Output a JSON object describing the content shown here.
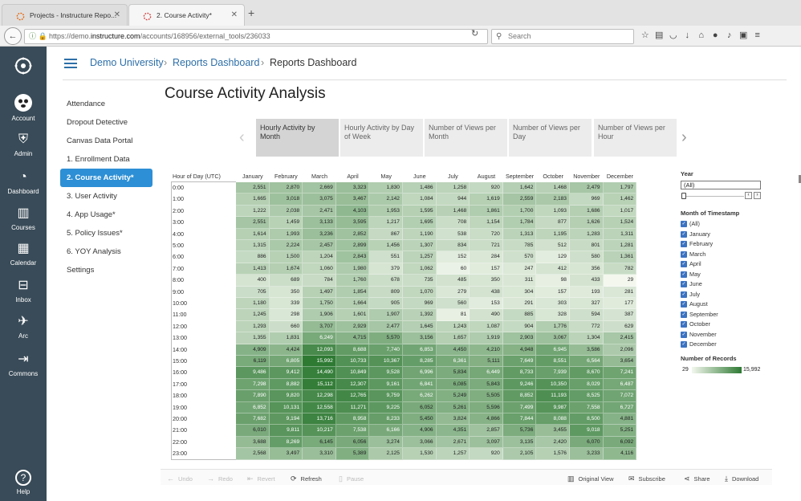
{
  "browser": {
    "tabs": [
      {
        "title": "Projects - Instructure Repo..."
      },
      {
        "title": "2. Course Activity*"
      }
    ],
    "url": {
      "prefix": "https://demo.",
      "domain": "instructure.com",
      "path": "/accounts/168956/external_tools/236033"
    },
    "search_placeholder": "Search"
  },
  "global_nav": {
    "items": [
      {
        "label": "Account",
        "icon": "account-avatar-icon"
      },
      {
        "label": "Admin",
        "icon": "admin-shield-icon"
      },
      {
        "label": "Dashboard",
        "icon": "dashboard-gauge-icon"
      },
      {
        "label": "Courses",
        "icon": "courses-book-icon"
      },
      {
        "label": "Calendar",
        "icon": "calendar-icon"
      },
      {
        "label": "Inbox",
        "icon": "inbox-tray-icon"
      },
      {
        "label": "Arc",
        "icon": "arc-icon"
      },
      {
        "label": "Commons",
        "icon": "commons-icon"
      },
      {
        "label": "Help",
        "icon": "help-circle-icon"
      }
    ]
  },
  "breadcrumb": [
    "Demo University",
    "Reports Dashboard",
    "Reports Dashboard"
  ],
  "sub_nav": [
    {
      "label": "Attendance",
      "active": false
    },
    {
      "label": "Dropout Detective",
      "active": false
    },
    {
      "label": "Canvas Data Portal",
      "active": false
    },
    {
      "label": "1. Enrollment Data",
      "active": false
    },
    {
      "label": "2. Course Activity*",
      "active": true
    },
    {
      "label": "3. User Activity",
      "active": false
    },
    {
      "label": "4. App Usage*",
      "active": false
    },
    {
      "label": "5. Policy Issues*",
      "active": false
    },
    {
      "label": "6. YOY Analysis",
      "active": false
    },
    {
      "label": "Settings",
      "active": false
    }
  ],
  "page_title": "Course Activity Analysis",
  "view_tabs": [
    {
      "label": "Hourly Activity by Month",
      "active": true
    },
    {
      "label": "Hourly Activity by Day of Week",
      "active": false
    },
    {
      "label": "Number of Views per Month",
      "active": false
    },
    {
      "label": "Number of Views per Day",
      "active": false
    },
    {
      "label": "Number of Views per Hour",
      "active": false
    }
  ],
  "chart_data": {
    "type": "heatmap",
    "row_header": "Hour of Day (UTC)",
    "columns": [
      "January",
      "February",
      "March",
      "April",
      "May",
      "June",
      "July",
      "August",
      "September",
      "October",
      "November",
      "December"
    ],
    "rows": [
      "0:00",
      "1:00",
      "2:00",
      "3:00",
      "4:00",
      "5:00",
      "6:00",
      "7:00",
      "8:00",
      "9:00",
      "10:00",
      "11:00",
      "12:00",
      "13:00",
      "14:00",
      "15:00",
      "16:00",
      "17:00",
      "18:00",
      "19:00",
      "20:00",
      "21:00",
      "22:00",
      "23:00"
    ],
    "values": [
      [
        2551,
        2870,
        2669,
        3323,
        1830,
        1486,
        1258,
        920,
        1642,
        1468,
        2479,
        1797
      ],
      [
        1665,
        3018,
        3075,
        3467,
        2142,
        1084,
        944,
        1619,
        2559,
        2183,
        969,
        1462
      ],
      [
        1222,
        2038,
        2471,
        4103,
        1953,
        1595,
        1468,
        1861,
        1700,
        1093,
        1686,
        1017
      ],
      [
        2551,
        1459,
        3133,
        3595,
        1217,
        1695,
        708,
        1154,
        1784,
        877,
        1626,
        1524
      ],
      [
        1614,
        1993,
        3236,
        2852,
        867,
        1190,
        538,
        720,
        1313,
        1195,
        1283,
        1311
      ],
      [
        1315,
        2224,
        2457,
        2899,
        1456,
        1307,
        834,
        721,
        785,
        512,
        801,
        1281
      ],
      [
        886,
        1500,
        1204,
        2843,
        551,
        1257,
        152,
        284,
        570,
        129,
        580,
        1361
      ],
      [
        1413,
        1674,
        1060,
        1980,
        379,
        1062,
        60,
        157,
        247,
        412,
        356,
        782
      ],
      [
        400,
        689,
        784,
        1760,
        678,
        735,
        485,
        350,
        311,
        98,
        433,
        29
      ],
      [
        705,
        350,
        1497,
        1854,
        809,
        1070,
        279,
        438,
        304,
        157,
        193,
        281
      ],
      [
        1180,
        339,
        1750,
        1664,
        905,
        969,
        560,
        153,
        291,
        303,
        327,
        177
      ],
      [
        1245,
        298,
        1906,
        1601,
        1907,
        1392,
        81,
        490,
        885,
        328,
        594,
        387
      ],
      [
        1293,
        660,
        3707,
        2929,
        2477,
        1645,
        1243,
        1087,
        904,
        1776,
        772,
        629
      ],
      [
        1355,
        1831,
        6249,
        4715,
        5570,
        3156,
        1657,
        1919,
        2903,
        3067,
        1304,
        2415
      ],
      [
        4909,
        4424,
        12093,
        8688,
        7740,
        6853,
        4450,
        4210,
        4948,
        6945,
        3586,
        2096
      ],
      [
        6119,
        6805,
        15992,
        10733,
        10367,
        8285,
        6361,
        5111,
        7649,
        8551,
        6564,
        3654
      ],
      [
        9486,
        9412,
        14490,
        10849,
        9528,
        6996,
        5834,
        6449,
        8733,
        7939,
        8670,
        7241
      ],
      [
        7298,
        8882,
        15112,
        12307,
        9161,
        6841,
        6085,
        5843,
        9246,
        10350,
        8029,
        6487
      ],
      [
        7890,
        9820,
        12298,
        12765,
        9759,
        6262,
        5249,
        5505,
        8852,
        11193,
        8525,
        7072
      ],
      [
        6852,
        10131,
        12558,
        11271,
        9225,
        6052,
        5261,
        5596,
        7499,
        9987,
        7558,
        6727
      ],
      [
        7682,
        9194,
        13716,
        8958,
        8233,
        5450,
        3824,
        4866,
        7844,
        8088,
        8500,
        4881
      ],
      [
        6010,
        9811,
        10217,
        7538,
        6166,
        4906,
        4351,
        2857,
        5736,
        3455,
        9018,
        5251
      ],
      [
        3688,
        8269,
        6145,
        6056,
        3274,
        3066,
        2671,
        3097,
        3135,
        2420,
        6070,
        6092
      ],
      [
        2568,
        3497,
        3310,
        5389,
        2125,
        1530,
        1257,
        920,
        2105,
        1576,
        3233,
        4116
      ]
    ],
    "color_min": 29,
    "color_max": 15992,
    "color_low": "#f3f7ee",
    "color_high": "#2e7a33"
  },
  "filters": {
    "year_label": "Year",
    "year_value": "(All)",
    "month_label": "Month of Timestamp",
    "months": [
      "(All)",
      "January",
      "February",
      "March",
      "April",
      "May",
      "June",
      "July",
      "August",
      "September",
      "October",
      "November",
      "December"
    ],
    "legend_label": "Number of Records",
    "legend_min": "29",
    "legend_max": "15,992"
  },
  "toolbar": {
    "undo": "Undo",
    "redo": "Redo",
    "revert": "Revert",
    "refresh": "Refresh",
    "pause": "Pause",
    "original_view": "Original View",
    "subscribe": "Subscribe",
    "share": "Share",
    "download": "Download"
  },
  "colors": {
    "nav_bg": "#394b58",
    "link": "#2d6fa8",
    "active_tab": "#2d8fd5"
  }
}
